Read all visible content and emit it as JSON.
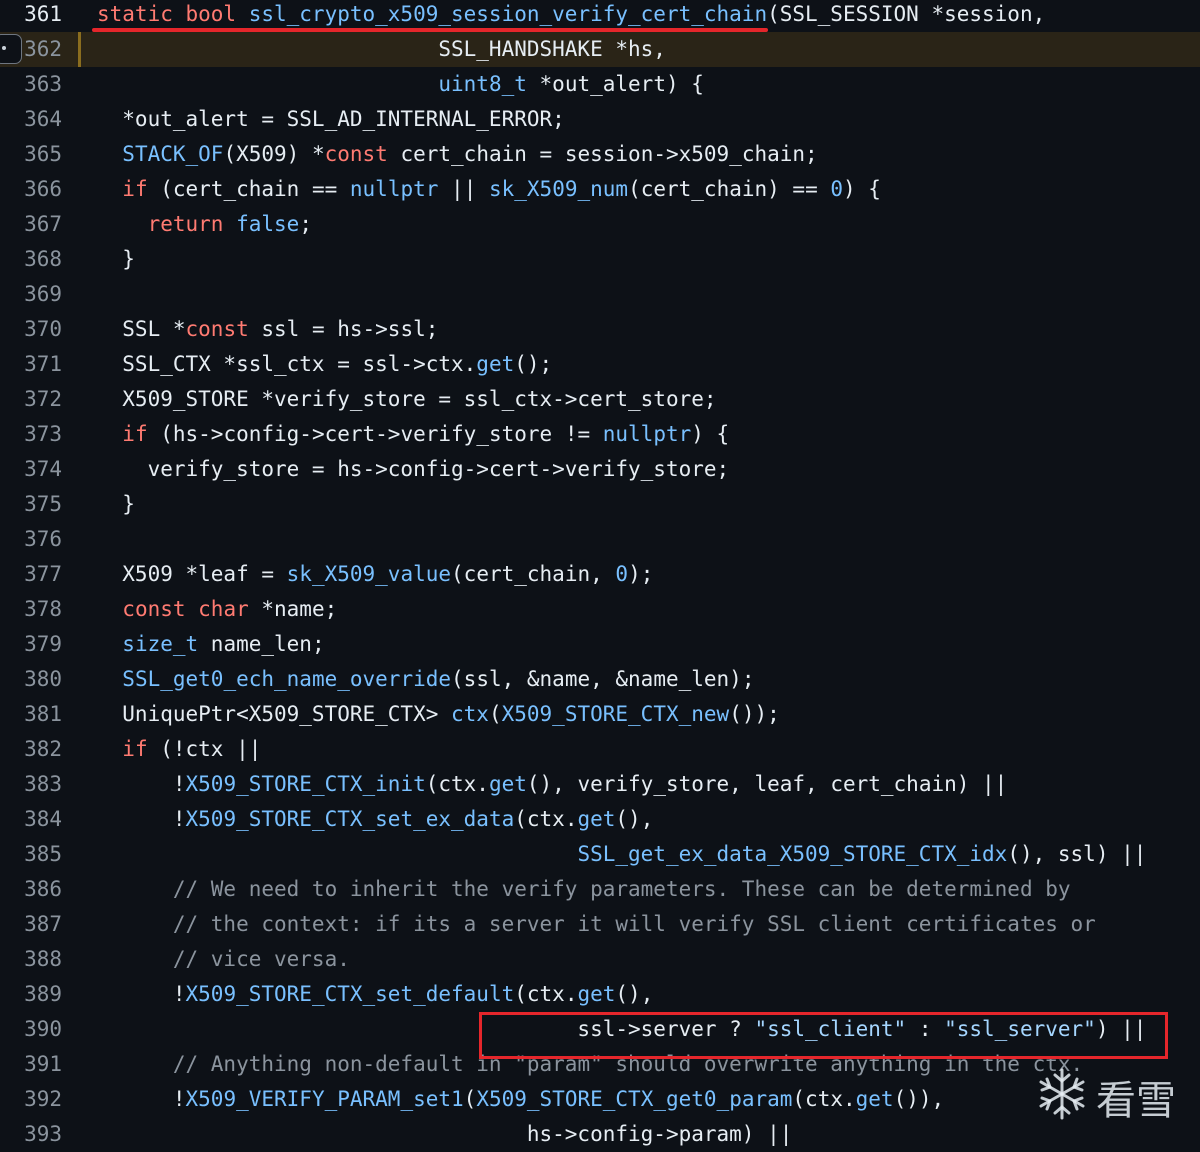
{
  "editor": {
    "highlighted_line": 362,
    "lines": [
      {
        "n": "361",
        "tokens": [
          [
            "kw",
            "static bool "
          ],
          [
            "fn",
            "ssl_crypto_x509_session_verify_cert_chain"
          ],
          [
            "",
            "(SSL_SESSION *session,"
          ]
        ]
      },
      {
        "n": "362",
        "tokens": [
          [
            "",
            "                           SSL_HANDSHAKE *hs,"
          ]
        ]
      },
      {
        "n": "363",
        "tokens": [
          [
            "",
            "                           "
          ],
          [
            "fn",
            "uint8_t"
          ],
          [
            "",
            " *out_alert) {"
          ]
        ]
      },
      {
        "n": "364",
        "tokens": [
          [
            "",
            "  *out_alert = SSL_AD_INTERNAL_ERROR;"
          ]
        ]
      },
      {
        "n": "365",
        "tokens": [
          [
            "",
            "  "
          ],
          [
            "fn",
            "STACK_OF"
          ],
          [
            "",
            "(X509) *"
          ],
          [
            "kw",
            "const"
          ],
          [
            "",
            " cert_chain = session->x509_chain;"
          ]
        ]
      },
      {
        "n": "366",
        "tokens": [
          [
            "",
            "  "
          ],
          [
            "kw",
            "if"
          ],
          [
            "",
            " (cert_chain == "
          ],
          [
            "fn",
            "nullptr"
          ],
          [
            "",
            " || "
          ],
          [
            "fn",
            "sk_X509_num"
          ],
          [
            "",
            "(cert_chain) == "
          ],
          [
            "fn",
            "0"
          ],
          [
            "",
            ") {"
          ]
        ]
      },
      {
        "n": "367",
        "tokens": [
          [
            "",
            "    "
          ],
          [
            "kw",
            "return"
          ],
          [
            "",
            " "
          ],
          [
            "fn",
            "false"
          ],
          [
            "",
            ";"
          ]
        ]
      },
      {
        "n": "368",
        "tokens": [
          [
            "",
            "  }"
          ]
        ]
      },
      {
        "n": "369",
        "tokens": []
      },
      {
        "n": "370",
        "tokens": [
          [
            "",
            "  SSL *"
          ],
          [
            "kw",
            "const"
          ],
          [
            "",
            " ssl = hs->ssl;"
          ]
        ]
      },
      {
        "n": "371",
        "tokens": [
          [
            "",
            "  SSL_CTX *ssl_ctx = ssl->ctx."
          ],
          [
            "fn",
            "get"
          ],
          [
            "",
            "();"
          ]
        ]
      },
      {
        "n": "372",
        "tokens": [
          [
            "",
            "  X509_STORE *verify_store = ssl_ctx->cert_store;"
          ]
        ]
      },
      {
        "n": "373",
        "tokens": [
          [
            "",
            "  "
          ],
          [
            "kw",
            "if"
          ],
          [
            "",
            " (hs->config->cert->verify_store != "
          ],
          [
            "fn",
            "nullptr"
          ],
          [
            "",
            ") {"
          ]
        ]
      },
      {
        "n": "374",
        "tokens": [
          [
            "",
            "    verify_store = hs->config->cert->verify_store;"
          ]
        ]
      },
      {
        "n": "375",
        "tokens": [
          [
            "",
            "  }"
          ]
        ]
      },
      {
        "n": "376",
        "tokens": []
      },
      {
        "n": "377",
        "tokens": [
          [
            "",
            "  X509 *leaf = "
          ],
          [
            "fn",
            "sk_X509_value"
          ],
          [
            "",
            "(cert_chain, "
          ],
          [
            "fn",
            "0"
          ],
          [
            "",
            ");"
          ]
        ]
      },
      {
        "n": "378",
        "tokens": [
          [
            "",
            "  "
          ],
          [
            "kw",
            "const char"
          ],
          [
            "",
            " *name;"
          ]
        ]
      },
      {
        "n": "379",
        "tokens": [
          [
            "",
            "  "
          ],
          [
            "fn",
            "size_t"
          ],
          [
            "",
            " name_len;"
          ]
        ]
      },
      {
        "n": "380",
        "tokens": [
          [
            "",
            "  "
          ],
          [
            "fn",
            "SSL_get0_ech_name_override"
          ],
          [
            "",
            "(ssl, &name, &name_len);"
          ]
        ]
      },
      {
        "n": "381",
        "tokens": [
          [
            "",
            "  UniquePtr<X509_STORE_CTX> "
          ],
          [
            "fn",
            "ctx"
          ],
          [
            "",
            "("
          ],
          [
            "fn",
            "X509_STORE_CTX_new"
          ],
          [
            "",
            "());"
          ]
        ]
      },
      {
        "n": "382",
        "tokens": [
          [
            "",
            "  "
          ],
          [
            "kw",
            "if"
          ],
          [
            "",
            " (!ctx ||"
          ]
        ]
      },
      {
        "n": "383",
        "tokens": [
          [
            "",
            "      !"
          ],
          [
            "fn",
            "X509_STORE_CTX_init"
          ],
          [
            "",
            "(ctx."
          ],
          [
            "fn",
            "get"
          ],
          [
            "",
            "(), verify_store, leaf, cert_chain) ||"
          ]
        ]
      },
      {
        "n": "384",
        "tokens": [
          [
            "",
            "      !"
          ],
          [
            "fn",
            "X509_STORE_CTX_set_ex_data"
          ],
          [
            "",
            "(ctx."
          ],
          [
            "fn",
            "get"
          ],
          [
            "",
            "(),"
          ]
        ]
      },
      {
        "n": "385",
        "tokens": [
          [
            "",
            "                                      "
          ],
          [
            "fn",
            "SSL_get_ex_data_X509_STORE_CTX_idx"
          ],
          [
            "",
            "(), ssl) ||"
          ]
        ]
      },
      {
        "n": "386",
        "tokens": [
          [
            "",
            "      "
          ],
          [
            "cm",
            "// We need to inherit the verify parameters. These can be determined by"
          ]
        ]
      },
      {
        "n": "387",
        "tokens": [
          [
            "",
            "      "
          ],
          [
            "cm",
            "// the context: if its a server it will verify SSL client certificates or"
          ]
        ]
      },
      {
        "n": "388",
        "tokens": [
          [
            "",
            "      "
          ],
          [
            "cm",
            "// vice versa."
          ]
        ]
      },
      {
        "n": "389",
        "tokens": [
          [
            "",
            "      !"
          ],
          [
            "fn",
            "X509_STORE_CTX_set_default"
          ],
          [
            "",
            "(ctx."
          ],
          [
            "fn",
            "get"
          ],
          [
            "",
            "(),"
          ]
        ]
      },
      {
        "n": "390",
        "tokens": [
          [
            "",
            "                                      ssl->server ? "
          ],
          [
            "st",
            "\"ssl_client\""
          ],
          [
            "",
            " : "
          ],
          [
            "st",
            "\"ssl_server\""
          ],
          [
            "",
            ") ||"
          ]
        ]
      },
      {
        "n": "391",
        "tokens": [
          [
            "",
            "      "
          ],
          [
            "cm",
            "// Anything non-default in \"param\" should overwrite anything in the ctx."
          ]
        ]
      },
      {
        "n": "392",
        "tokens": [
          [
            "",
            "      !"
          ],
          [
            "fn",
            "X509_VERIFY_PARAM_set1"
          ],
          [
            "",
            "("
          ],
          [
            "fn",
            "X509_STORE_CTX_get0_param"
          ],
          [
            "",
            "(ctx."
          ],
          [
            "fn",
            "get"
          ],
          [
            "",
            "()),"
          ]
        ]
      },
      {
        "n": "393",
        "tokens": [
          [
            "",
            "                                  hs->config->param) ||"
          ]
        ]
      }
    ]
  },
  "watermark": {
    "text": "看雪",
    "icon": "snowflake-icon"
  },
  "annotations": {
    "underline_line": 361,
    "box_line": 390
  }
}
